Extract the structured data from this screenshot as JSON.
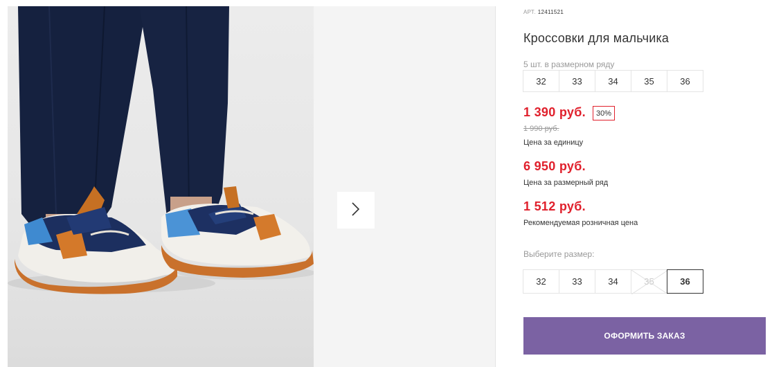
{
  "product": {
    "article_label": "АРТ.",
    "article_value": "12411521",
    "title": "Кроссовки для мальчика"
  },
  "pack": {
    "caption": "5 шт. в размерном ряду",
    "sizes": [
      "32",
      "33",
      "34",
      "35",
      "36"
    ]
  },
  "prices": {
    "unit_price": "1 390 руб.",
    "discount": "30%",
    "old_price": "1 990 руб.",
    "unit_label": "Цена за единицу",
    "pack_price": "6 950 руб.",
    "pack_label": "Цена за размерный ряд",
    "retail_price": "1 512 руб.",
    "retail_label": "Рекомендуемая розничная цена"
  },
  "size_select": {
    "caption": "Выберите размер:",
    "sizes": [
      "32",
      "33",
      "34",
      "35",
      "36"
    ],
    "disabled": "35",
    "selected": "36"
  },
  "order_button": {
    "label": "ОФОРМИТЬ ЗАКАЗ"
  },
  "gallery": {
    "next_icon": "chevron-right-icon"
  },
  "colors": {
    "price_red": "#e0202c",
    "button_purple": "#7b62a3",
    "border_gray": "#e4e4e4"
  }
}
